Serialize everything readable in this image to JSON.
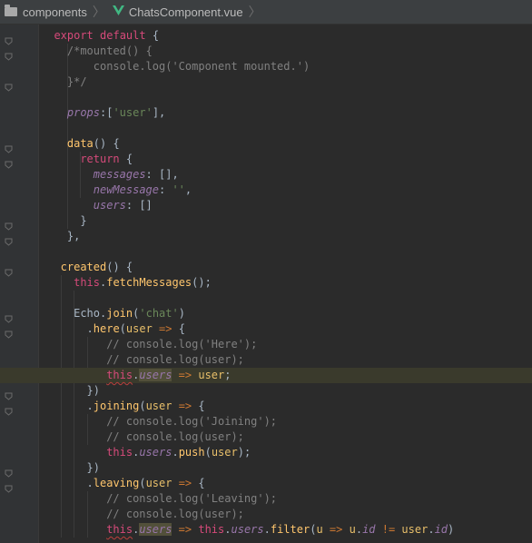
{
  "breadcrumb": {
    "folder": "components",
    "file": "ChatsComponent.vue",
    "file_icon": "vue-icon",
    "folder_icon": "folder-icon"
  },
  "editor": {
    "theme_background": "#2b2b2b",
    "highlighted_line_index": 22,
    "lines": [
      {
        "indent": 2,
        "tokens": [
          {
            "t": "export",
            "c": "kw2"
          },
          {
            "t": " "
          },
          {
            "t": "default",
            "c": "kw2"
          },
          {
            "t": " {",
            "c": "plain"
          }
        ]
      },
      {
        "indent": 4,
        "tokens": [
          {
            "t": "/*mounted() {",
            "c": "cm"
          }
        ]
      },
      {
        "indent": 8,
        "tokens": [
          {
            "t": "console.log('Component mounted.')",
            "c": "cm"
          }
        ]
      },
      {
        "indent": 4,
        "tokens": [
          {
            "t": "}*/",
            "c": "cm"
          }
        ]
      },
      {
        "indent": 0,
        "tokens": []
      },
      {
        "indent": 4,
        "tokens": [
          {
            "t": "props",
            "c": "purple"
          },
          {
            "t": ":[",
            "c": "plain"
          },
          {
            "t": "'user'",
            "c": "str"
          },
          {
            "t": "],",
            "c": "plain"
          }
        ]
      },
      {
        "indent": 0,
        "tokens": []
      },
      {
        "indent": 4,
        "tokens": [
          {
            "t": "data",
            "c": "fn"
          },
          {
            "t": "() {",
            "c": "plain"
          }
        ]
      },
      {
        "indent": 6,
        "tokens": [
          {
            "t": "return",
            "c": "kw2"
          },
          {
            "t": " {",
            "c": "plain"
          }
        ]
      },
      {
        "indent": 8,
        "tokens": [
          {
            "t": "messages",
            "c": "purple"
          },
          {
            "t": ": [],",
            "c": "plain"
          }
        ]
      },
      {
        "indent": 8,
        "tokens": [
          {
            "t": "newMessage",
            "c": "purple"
          },
          {
            "t": ": ",
            "c": "plain"
          },
          {
            "t": "''",
            "c": "str"
          },
          {
            "t": ",",
            "c": "plain"
          }
        ]
      },
      {
        "indent": 8,
        "tokens": [
          {
            "t": "users",
            "c": "purple"
          },
          {
            "t": ": []",
            "c": "plain"
          }
        ]
      },
      {
        "indent": 6,
        "tokens": [
          {
            "t": "}",
            "c": "plain"
          }
        ]
      },
      {
        "indent": 4,
        "tokens": [
          {
            "t": "},",
            "c": "plain"
          }
        ]
      },
      {
        "indent": 0,
        "tokens": []
      },
      {
        "indent": 3,
        "tokens": [
          {
            "t": "created",
            "c": "fn"
          },
          {
            "t": "() {",
            "c": "plain"
          }
        ]
      },
      {
        "indent": 5,
        "tokens": [
          {
            "t": "this",
            "c": "kw2"
          },
          {
            "t": ".",
            "c": "plain"
          },
          {
            "t": "fetchMessages",
            "c": "fn"
          },
          {
            "t": "();",
            "c": "plain"
          }
        ]
      },
      {
        "indent": 0,
        "tokens": []
      },
      {
        "indent": 5,
        "tokens": [
          {
            "t": "Echo",
            "c": "plain"
          },
          {
            "t": ".",
            "c": "plain"
          },
          {
            "t": "join",
            "c": "fn"
          },
          {
            "t": "(",
            "c": "plain"
          },
          {
            "t": "'chat'",
            "c": "str"
          },
          {
            "t": ")",
            "c": "plain"
          }
        ]
      },
      {
        "indent": 7,
        "tokens": [
          {
            "t": ".",
            "c": "plain"
          },
          {
            "t": "here",
            "c": "fn"
          },
          {
            "t": "(",
            "c": "plain"
          },
          {
            "t": "user",
            "c": "var"
          },
          {
            "t": " => ",
            "c": "kw"
          },
          {
            "t": "{",
            "c": "plain"
          }
        ]
      },
      {
        "indent": 10,
        "tokens": [
          {
            "t": "// console.log('Here');",
            "c": "cm"
          }
        ]
      },
      {
        "indent": 10,
        "tokens": [
          {
            "t": "// console.log(user);",
            "c": "cm"
          }
        ]
      },
      {
        "indent": 10,
        "tokens": [
          {
            "t": "this",
            "c": "kw2 warn"
          },
          {
            "t": ".",
            "c": "plain"
          },
          {
            "t": "users",
            "c": "purple hl-box"
          },
          {
            "t": " => ",
            "c": "kw"
          },
          {
            "t": "user",
            "c": "var"
          },
          {
            "t": ";",
            "c": "plain"
          }
        ]
      },
      {
        "indent": 7,
        "tokens": [
          {
            "t": "})",
            "c": "plain"
          }
        ]
      },
      {
        "indent": 7,
        "tokens": [
          {
            "t": ".",
            "c": "plain"
          },
          {
            "t": "joining",
            "c": "fn"
          },
          {
            "t": "(",
            "c": "plain"
          },
          {
            "t": "user",
            "c": "var"
          },
          {
            "t": " => ",
            "c": "kw"
          },
          {
            "t": "{",
            "c": "plain"
          }
        ]
      },
      {
        "indent": 10,
        "tokens": [
          {
            "t": "// console.log('Joining');",
            "c": "cm"
          }
        ]
      },
      {
        "indent": 10,
        "tokens": [
          {
            "t": "// console.log(user);",
            "c": "cm"
          }
        ]
      },
      {
        "indent": 10,
        "tokens": [
          {
            "t": "this",
            "c": "kw2"
          },
          {
            "t": ".",
            "c": "plain"
          },
          {
            "t": "users",
            "c": "purple"
          },
          {
            "t": ".",
            "c": "plain"
          },
          {
            "t": "push",
            "c": "fn"
          },
          {
            "t": "(",
            "c": "plain"
          },
          {
            "t": "user",
            "c": "var"
          },
          {
            "t": ");",
            "c": "plain"
          }
        ]
      },
      {
        "indent": 7,
        "tokens": [
          {
            "t": "})",
            "c": "plain"
          }
        ]
      },
      {
        "indent": 7,
        "tokens": [
          {
            "t": ".",
            "c": "plain"
          },
          {
            "t": "leaving",
            "c": "fn"
          },
          {
            "t": "(",
            "c": "plain"
          },
          {
            "t": "user",
            "c": "var"
          },
          {
            "t": " => ",
            "c": "kw"
          },
          {
            "t": "{",
            "c": "plain"
          }
        ]
      },
      {
        "indent": 10,
        "tokens": [
          {
            "t": "// console.log('Leaving');",
            "c": "cm"
          }
        ]
      },
      {
        "indent": 10,
        "tokens": [
          {
            "t": "// console.log(user);",
            "c": "cm"
          }
        ]
      },
      {
        "indent": 10,
        "tokens": [
          {
            "t": "this",
            "c": "kw2 warn"
          },
          {
            "t": ".",
            "c": "plain"
          },
          {
            "t": "users",
            "c": "purple hl-box"
          },
          {
            "t": " => ",
            "c": "kw"
          },
          {
            "t": "this",
            "c": "kw2"
          },
          {
            "t": ".",
            "c": "plain"
          },
          {
            "t": "users",
            "c": "purple"
          },
          {
            "t": ".",
            "c": "plain"
          },
          {
            "t": "filter",
            "c": "fn"
          },
          {
            "t": "(",
            "c": "plain"
          },
          {
            "t": "u",
            "c": "var"
          },
          {
            "t": " => ",
            "c": "kw"
          },
          {
            "t": "u",
            "c": "var"
          },
          {
            "t": ".",
            "c": "plain"
          },
          {
            "t": "id",
            "c": "purple"
          },
          {
            "t": " != ",
            "c": "kw"
          },
          {
            "t": "user",
            "c": "var"
          },
          {
            "t": ".",
            "c": "plain"
          },
          {
            "t": "id",
            "c": "purple"
          },
          {
            "t": ")",
            "c": "plain"
          }
        ]
      }
    ]
  }
}
